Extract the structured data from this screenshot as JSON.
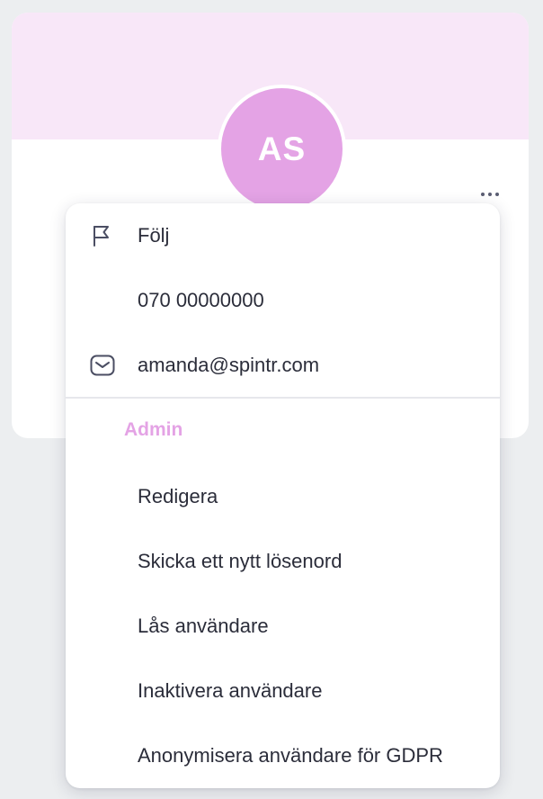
{
  "profile": {
    "initials": "AS",
    "banner_color": "#f8e7f8",
    "avatar_color": "#e4a3e5"
  },
  "menu": {
    "contact_items": [
      {
        "label": "Följ",
        "icon": "flag-icon"
      },
      {
        "label": "070 00000000",
        "icon": null
      },
      {
        "label": "amanda@spintr.com",
        "icon": "mail-icon"
      }
    ],
    "admin_header": "Admin",
    "admin_items": [
      {
        "label": "Redigera"
      },
      {
        "label": "Skicka ett nytt lösenord"
      },
      {
        "label": "Lås användare"
      },
      {
        "label": "Inaktivera användare"
      },
      {
        "label": "Anonymisera användare för GDPR"
      }
    ],
    "more_icon": "more-horizontal-icon",
    "accent_color": "#e4a3e5"
  }
}
